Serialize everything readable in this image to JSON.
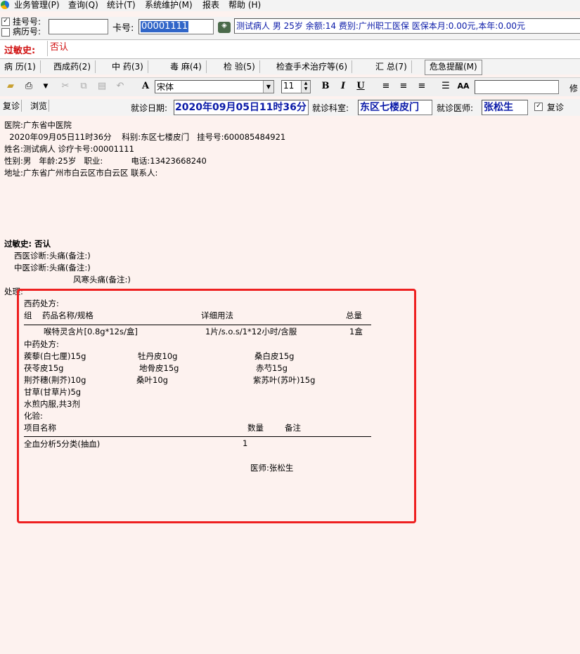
{
  "menu": {
    "items": [
      "业务管理(P)",
      "查询(Q)",
      "统计(T)",
      "系统维护(M)",
      "报表",
      "帮助 (H)"
    ]
  },
  "registration": {
    "reg_no_label": "挂号号:",
    "record_no_label": "病历号:",
    "reg_no_checked": true,
    "record_no_checked": false,
    "reg_no_value": "",
    "card_label": "卡号:",
    "card_value": "00001111",
    "patient_info": "测试病人  男  25岁  余额:14  费别:广州职工医保  医保本月:0.00元,本年:0.00元"
  },
  "allergy": {
    "label": "过敏史:",
    "value": "否认"
  },
  "tabs": [
    "病 历(1)",
    "西成药(2)",
    "中 药(3)",
    "毒 麻(4)",
    "检 验(5)",
    "检查手术治疗等(6)",
    "汇 总(7)",
    "危急提醒(M)"
  ],
  "toolbar": {
    "font_name": "宋体",
    "font_size": "11",
    "right_label": "修"
  },
  "visit": {
    "revisit_btn": "复诊",
    "browse_btn": "浏览",
    "date_label": "就诊日期:",
    "date_value": "2020年09月05日11时36分",
    "dept_label": "就诊科室:",
    "dept_value": "东区七楼皮门",
    "doctor_label": "就诊医师:",
    "doctor_value": "张松生",
    "revisit_check_label": "复诊",
    "revisit_checked": true
  },
  "record": {
    "hospital": "医院:广东省中医院",
    "visit_line": "  2020年09月05日11时36分    科别:东区七楼皮门   挂号号:600085484921",
    "name_line": "姓名:测试病人   诊疗卡号:00001111",
    "sex_line": "性别:男   年龄:25岁   职业:           电话:13423668240",
    "address_line": "地址:广东省广州市白云区市白云区   联系人:",
    "allergy_line": "过敏史: 否认",
    "west_diag": "西医诊断:头痛(备注:)",
    "tcm_diag": "中医诊断:头痛(备注:)",
    "tcm_diag2": "风寒头痛(备注:)",
    "treatment_label": "处理:",
    "west_rx_title": "西药处方:",
    "west_rx_headers": [
      "组",
      "药品名称/规格",
      "详细用法",
      "总量"
    ],
    "west_rx_rows": [
      {
        "name": "喉特灵含片[0.8g*12s/盒]",
        "usage": "1片/s.o.s/1*12小时/含服",
        "total": "1盒"
      }
    ],
    "tcm_rx_title": "中药处方:",
    "tcm_herbs": [
      [
        "蒺藜(白七厘)15g",
        "牡丹皮10g",
        "桑白皮15g"
      ],
      [
        "茯苓皮15g",
        "地骨皮15g",
        "赤芍15g"
      ],
      [
        "荆芥穗(荆芥)10g",
        "桑叶10g",
        "紫苏叶(苏叶)15g"
      ],
      [
        "甘草(甘草片)5g",
        "",
        ""
      ]
    ],
    "tcm_usage": "水煎内服,共3剂",
    "lab_title": "化验:",
    "lab_headers": [
      "项目名称",
      "数量",
      "备注"
    ],
    "lab_rows": [
      {
        "name": "全血分析5分类(抽血)",
        "qty": "1",
        "note": ""
      }
    ],
    "physician": "医师:张松生"
  },
  "colors": {
    "content_bg": "#fdf2ef",
    "highlight_box": "#ee2020",
    "accent_text": "#0a1aa8",
    "allergy_red": "#d01010"
  }
}
